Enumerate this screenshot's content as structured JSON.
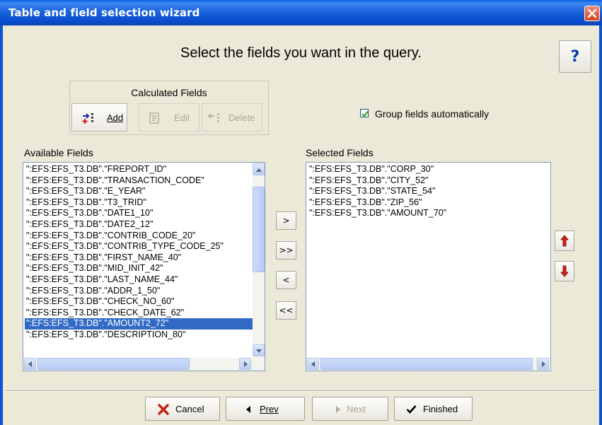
{
  "window": {
    "title": "Table and field selection wizard"
  },
  "heading": "Select the fields you want in the query.",
  "help_button": {
    "label": "?"
  },
  "calculated_fields": {
    "title": "Calculated Fields",
    "add_label": "Add",
    "edit_label": "Edit",
    "delete_label": "Delete"
  },
  "group_checkbox": {
    "label": "Group fields automatically",
    "checked": true
  },
  "available": {
    "label": "Available Fields",
    "items": [
      "\":EFS:EFS_T3.DB\".\"FREPORT_ID\"",
      "\":EFS:EFS_T3.DB\".\"TRANSACTION_CODE\"",
      "\":EFS:EFS_T3.DB\".\"E_YEAR\"",
      "\":EFS:EFS_T3.DB\".\"T3_TRID\"",
      "\":EFS:EFS_T3.DB\".\"DATE1_10\"",
      "\":EFS:EFS_T3.DB\".\"DATE2_12\"",
      "\":EFS:EFS_T3.DB\".\"CONTRIB_CODE_20\"",
      "\":EFS:EFS_T3.DB\".\"CONTRIB_TYPE_CODE_25\"",
      "\":EFS:EFS_T3.DB\".\"FIRST_NAME_40\"",
      "\":EFS:EFS_T3.DB\".\"MID_INIT_42\"",
      "\":EFS:EFS_T3.DB\".\"LAST_NAME_44\"",
      "\":EFS:EFS_T3.DB\".\"ADDR_1_50\"",
      "\":EFS:EFS_T3.DB\".\"CHECK_NO_60\"",
      "\":EFS:EFS_T3.DB\".\"CHECK_DATE_62\"",
      "\":EFS:EFS_T3.DB\".\"AMOUNT2_72\"",
      "\":EFS:EFS_T3.DB\".\"DESCRIPTION_80\""
    ],
    "selected_index": 14
  },
  "selected": {
    "label": "Selected Fields",
    "items": [
      "\":EFS:EFS_T3.DB\".\"CORP_30\"",
      "\":EFS:EFS_T3.DB\".\"CITY_52\"",
      "\":EFS:EFS_T3.DB\".\"STATE_54\"",
      "\":EFS:EFS_T3.DB\".\"ZIP_56\"",
      "\":EFS:EFS_T3.DB\".\"AMOUNT_70\""
    ]
  },
  "move_buttons": {
    "add_one": ">",
    "add_all": ">>",
    "remove_one": "<",
    "remove_all": "<<"
  },
  "footer": {
    "cancel_label": "Cancel",
    "prev_label": "Prev",
    "next_label": "Next",
    "finished_label": "Finished"
  },
  "colors": {
    "title_bar": "#0a54d8",
    "selection": "#316ac5",
    "dialog_bg": "#ece9d8"
  }
}
